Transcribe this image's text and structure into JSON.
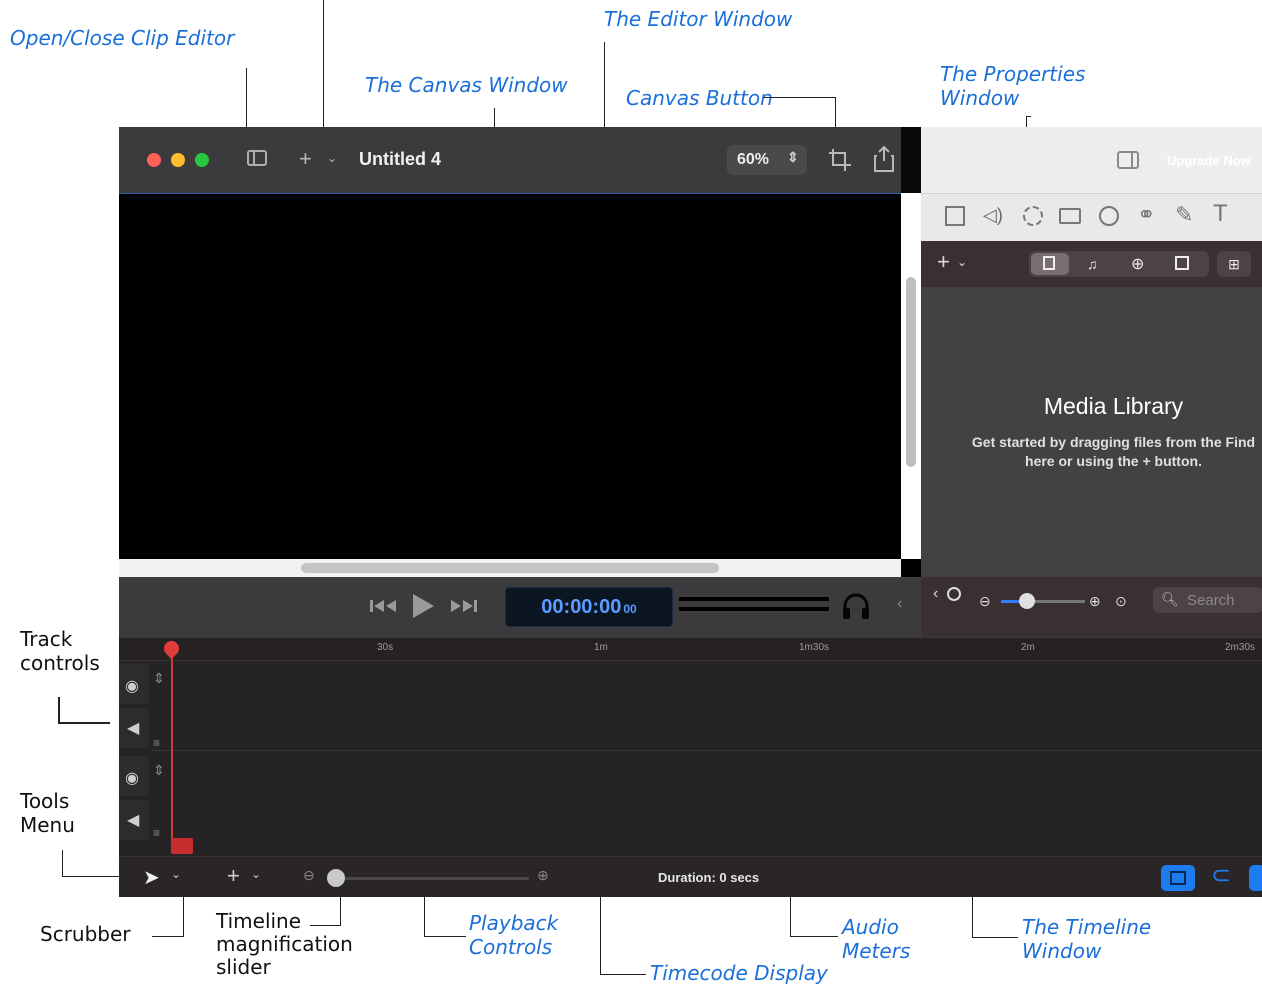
{
  "callouts": {
    "open_close_clip_editor": "Open/Close Clip Editor",
    "editor_window": "The Editor Window",
    "canvas_window": "The Canvas Window",
    "canvas_button": "Canvas Button",
    "properties_window": "The Properties\nWindow",
    "track_controls": "Track\ncontrols",
    "tools_menu": "Tools\nMenu",
    "scrubber": "Scrubber",
    "timeline_slider": "Timeline\nmagnification\nslider",
    "playback_controls": "Playback\nControls",
    "timecode_display": "Timecode Display",
    "audio_meters": "Audio\nMeters",
    "timeline_window": "The Timeline\nWindow"
  },
  "titlebar": {
    "title": "Untitled 4",
    "zoom": "60%"
  },
  "playback": {
    "timecode": "00:00:00",
    "frames": "00"
  },
  "properties": {
    "upgrade": "Upgrade Now",
    "media_library_title": "Media Library",
    "media_library_hint": "Get started by dragging files from the Find\nhere or using the + button.",
    "search_placeholder": "Search"
  },
  "timeline": {
    "ticks": [
      "30s",
      "1m",
      "1m30s",
      "2m",
      "2m30s"
    ],
    "duration": "Duration: 0 secs"
  },
  "colors": {
    "accent": "#1a6fd8",
    "scrubber": "#e03c3c",
    "timecode": "#5a9cff"
  }
}
